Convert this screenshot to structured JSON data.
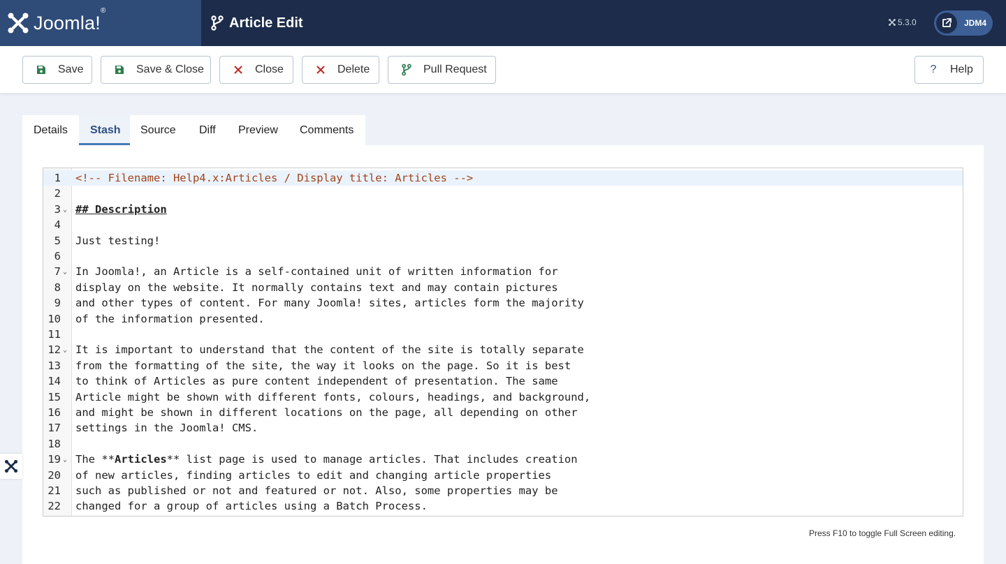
{
  "header": {
    "brand_name": "Joomla!",
    "brand_mark": "®",
    "page_title": "Article Edit",
    "version": "5.3.0",
    "user_label": "JDM4"
  },
  "toolbar": {
    "buttons": [
      {
        "label": "Save",
        "icon": "save-icon"
      },
      {
        "label": "Save & Close",
        "icon": "save-icon"
      },
      {
        "label": "Close",
        "icon": "close-icon"
      },
      {
        "label": "Delete",
        "icon": "close-icon"
      },
      {
        "label": "Pull Request",
        "icon": "branch-icon"
      }
    ],
    "help_label": "Help",
    "help_icon": "?"
  },
  "tabs": [
    {
      "label": "Details",
      "active": false
    },
    {
      "label": "Stash",
      "active": true
    },
    {
      "label": "Source",
      "active": false
    },
    {
      "label": "Diff",
      "active": false
    },
    {
      "label": "Preview",
      "active": false
    },
    {
      "label": "Comments",
      "active": false
    }
  ],
  "editor": {
    "lines": [
      {
        "n": "1",
        "text": "<!-- Filename: Help4.x:Articles / Display title: Articles -->"
      },
      {
        "n": "2",
        "text": ""
      },
      {
        "n": "3",
        "text": "## Description"
      },
      {
        "n": "4",
        "text": ""
      },
      {
        "n": "5",
        "text": "Just testing!"
      },
      {
        "n": "6",
        "text": ""
      },
      {
        "n": "7",
        "text": "In Joomla!, an Article is a self-contained unit of written information for"
      },
      {
        "n": "8",
        "text": "display on the website. It normally contains text and may contain pictures"
      },
      {
        "n": "9",
        "text": "and other types of content. For many Joomla! sites, articles form the majority"
      },
      {
        "n": "10",
        "text": "of the information presented."
      },
      {
        "n": "11",
        "text": ""
      },
      {
        "n": "12",
        "text": "It is important to understand that the content of the site is totally separate"
      },
      {
        "n": "13",
        "text": "from the formatting of the site, the way it looks on the page. So it is best"
      },
      {
        "n": "14",
        "text": "to think of Articles as pure content independent of presentation. The same"
      },
      {
        "n": "15",
        "text": "Article might be shown with different fonts, colours, headings, and background,"
      },
      {
        "n": "16",
        "text": "and might be shown in different locations on the page, all depending on other"
      },
      {
        "n": "17",
        "text": "settings in the Joomla! CMS."
      },
      {
        "n": "18",
        "text": ""
      },
      {
        "n": "19",
        "text": "The **Articles** list page is used to manage articles. That includes creation"
      },
      {
        "n": "20",
        "text": "of new articles, finding articles to edit and changing article properties"
      },
      {
        "n": "21",
        "text": "such as published or not and featured or not. Also, some properties may be"
      },
      {
        "n": "22",
        "text": "changed for a group of articles using a Batch Process."
      }
    ],
    "fold_lines": [
      "3",
      "7",
      "12",
      "19"
    ]
  },
  "footer_hint": "Press F10 to toggle Full Screen editing.",
  "colors": {
    "header_bg": "#1c2c4a",
    "brand_bg": "#2f4b78",
    "save_green": "#2f7d4f",
    "delete_red": "#c3261d",
    "tab_active": "#2f4f80"
  }
}
